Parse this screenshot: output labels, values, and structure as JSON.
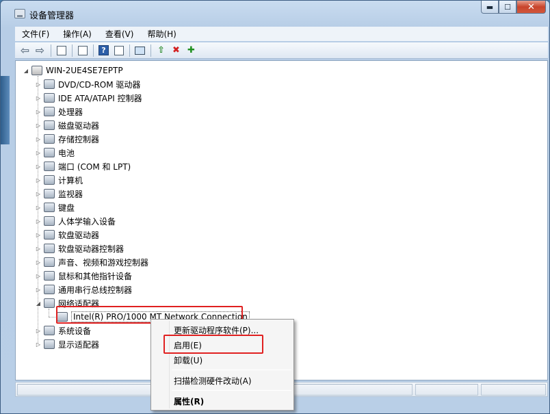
{
  "window": {
    "title": "设备管理器"
  },
  "caption": {
    "minimize": "▬",
    "maximize": "☐",
    "close": "✕"
  },
  "menu": [
    {
      "label": "文件(F)"
    },
    {
      "label": "操作(A)"
    },
    {
      "label": "查看(V)"
    },
    {
      "label": "帮助(H)"
    }
  ],
  "toolbar": [
    {
      "icon": "back-arrow-icon",
      "glyph": "⇦"
    },
    {
      "icon": "forward-arrow-icon",
      "glyph": "⇨"
    },
    {
      "icon": "show-hide-tree-icon"
    },
    {
      "icon": "properties-icon"
    },
    {
      "icon": "help-icon",
      "glyph": "?"
    },
    {
      "icon": "action-pane-icon"
    },
    {
      "icon": "scan-hardware-icon"
    },
    {
      "icon": "update-driver-icon",
      "glyph": "⇧"
    },
    {
      "icon": "uninstall-icon",
      "glyph": "✖"
    },
    {
      "icon": "enable-device-icon",
      "glyph": "✚"
    }
  ],
  "tree": {
    "root": "WIN-2UE4SE7EPTP",
    "categories": [
      "DVD/CD-ROM 驱动器",
      "IDE ATA/ATAPI 控制器",
      "处理器",
      "磁盘驱动器",
      "存储控制器",
      "电池",
      "端口 (COM 和 LPT)",
      "计算机",
      "监视器",
      "键盘",
      "人体学输入设备",
      "软盘驱动器",
      "软盘驱动器控制器",
      "声音、视频和游戏控制器",
      "鼠标和其他指针设备",
      "通用串行总线控制器",
      "网络适配器"
    ],
    "network_child": "Intel(R) PRO/1000 MT Network Connection",
    "after": [
      "系统设备",
      "显示适配器"
    ]
  },
  "context_menu": {
    "update": "更新驱动程序软件(P)...",
    "enable": "启用(E)",
    "uninstall": "卸载(U)",
    "scan": "扫描检测硬件改动(A)",
    "properties": "属性(R)"
  },
  "colors": {
    "highlight": "#e02020"
  }
}
